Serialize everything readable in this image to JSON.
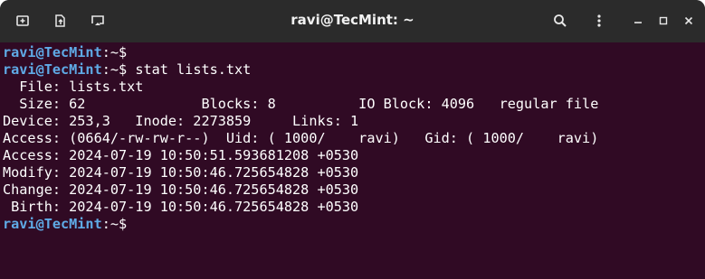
{
  "window": {
    "title": "ravi@TecMint: ~",
    "colors": {
      "titlebar": "#2b2b2b",
      "terminal_bg": "#300a24",
      "prompt_user": "#5faae6",
      "text": "#ffffff"
    }
  },
  "toolbar": {
    "new_tab_icon": "new-tab-icon",
    "export_icon": "export-icon",
    "cast_icon": "cast-icon",
    "search_icon": "search-icon",
    "menu_icon": "kebab-menu-icon",
    "minimize_icon": "minimize-icon",
    "maximize_icon": "maximize-icon",
    "close_icon": "close-icon"
  },
  "terminal": {
    "prompt_user": "ravi@TecMint",
    "prompt_path": ":~$",
    "lines": [
      {
        "type": "prompt",
        "command": ""
      },
      {
        "type": "prompt",
        "command": " stat lists.txt"
      },
      {
        "type": "output",
        "text": "  File: lists.txt"
      },
      {
        "type": "output",
        "text": "  Size: 62              Blocks: 8          IO Block: 4096   regular file"
      },
      {
        "type": "output",
        "text": "Device: 253,3   Inode: 2273859     Links: 1"
      },
      {
        "type": "output",
        "text": "Access: (0664/-rw-rw-r--)  Uid: ( 1000/    ravi)   Gid: ( 1000/    ravi)"
      },
      {
        "type": "output",
        "text": "Access: 2024-07-19 10:50:51.593681208 +0530"
      },
      {
        "type": "output",
        "text": "Modify: 2024-07-19 10:50:46.725654828 +0530"
      },
      {
        "type": "output",
        "text": "Change: 2024-07-19 10:50:46.725654828 +0530"
      },
      {
        "type": "output",
        "text": " Birth: 2024-07-19 10:50:46.725654828 +0530"
      },
      {
        "type": "prompt",
        "command": ""
      }
    ]
  }
}
